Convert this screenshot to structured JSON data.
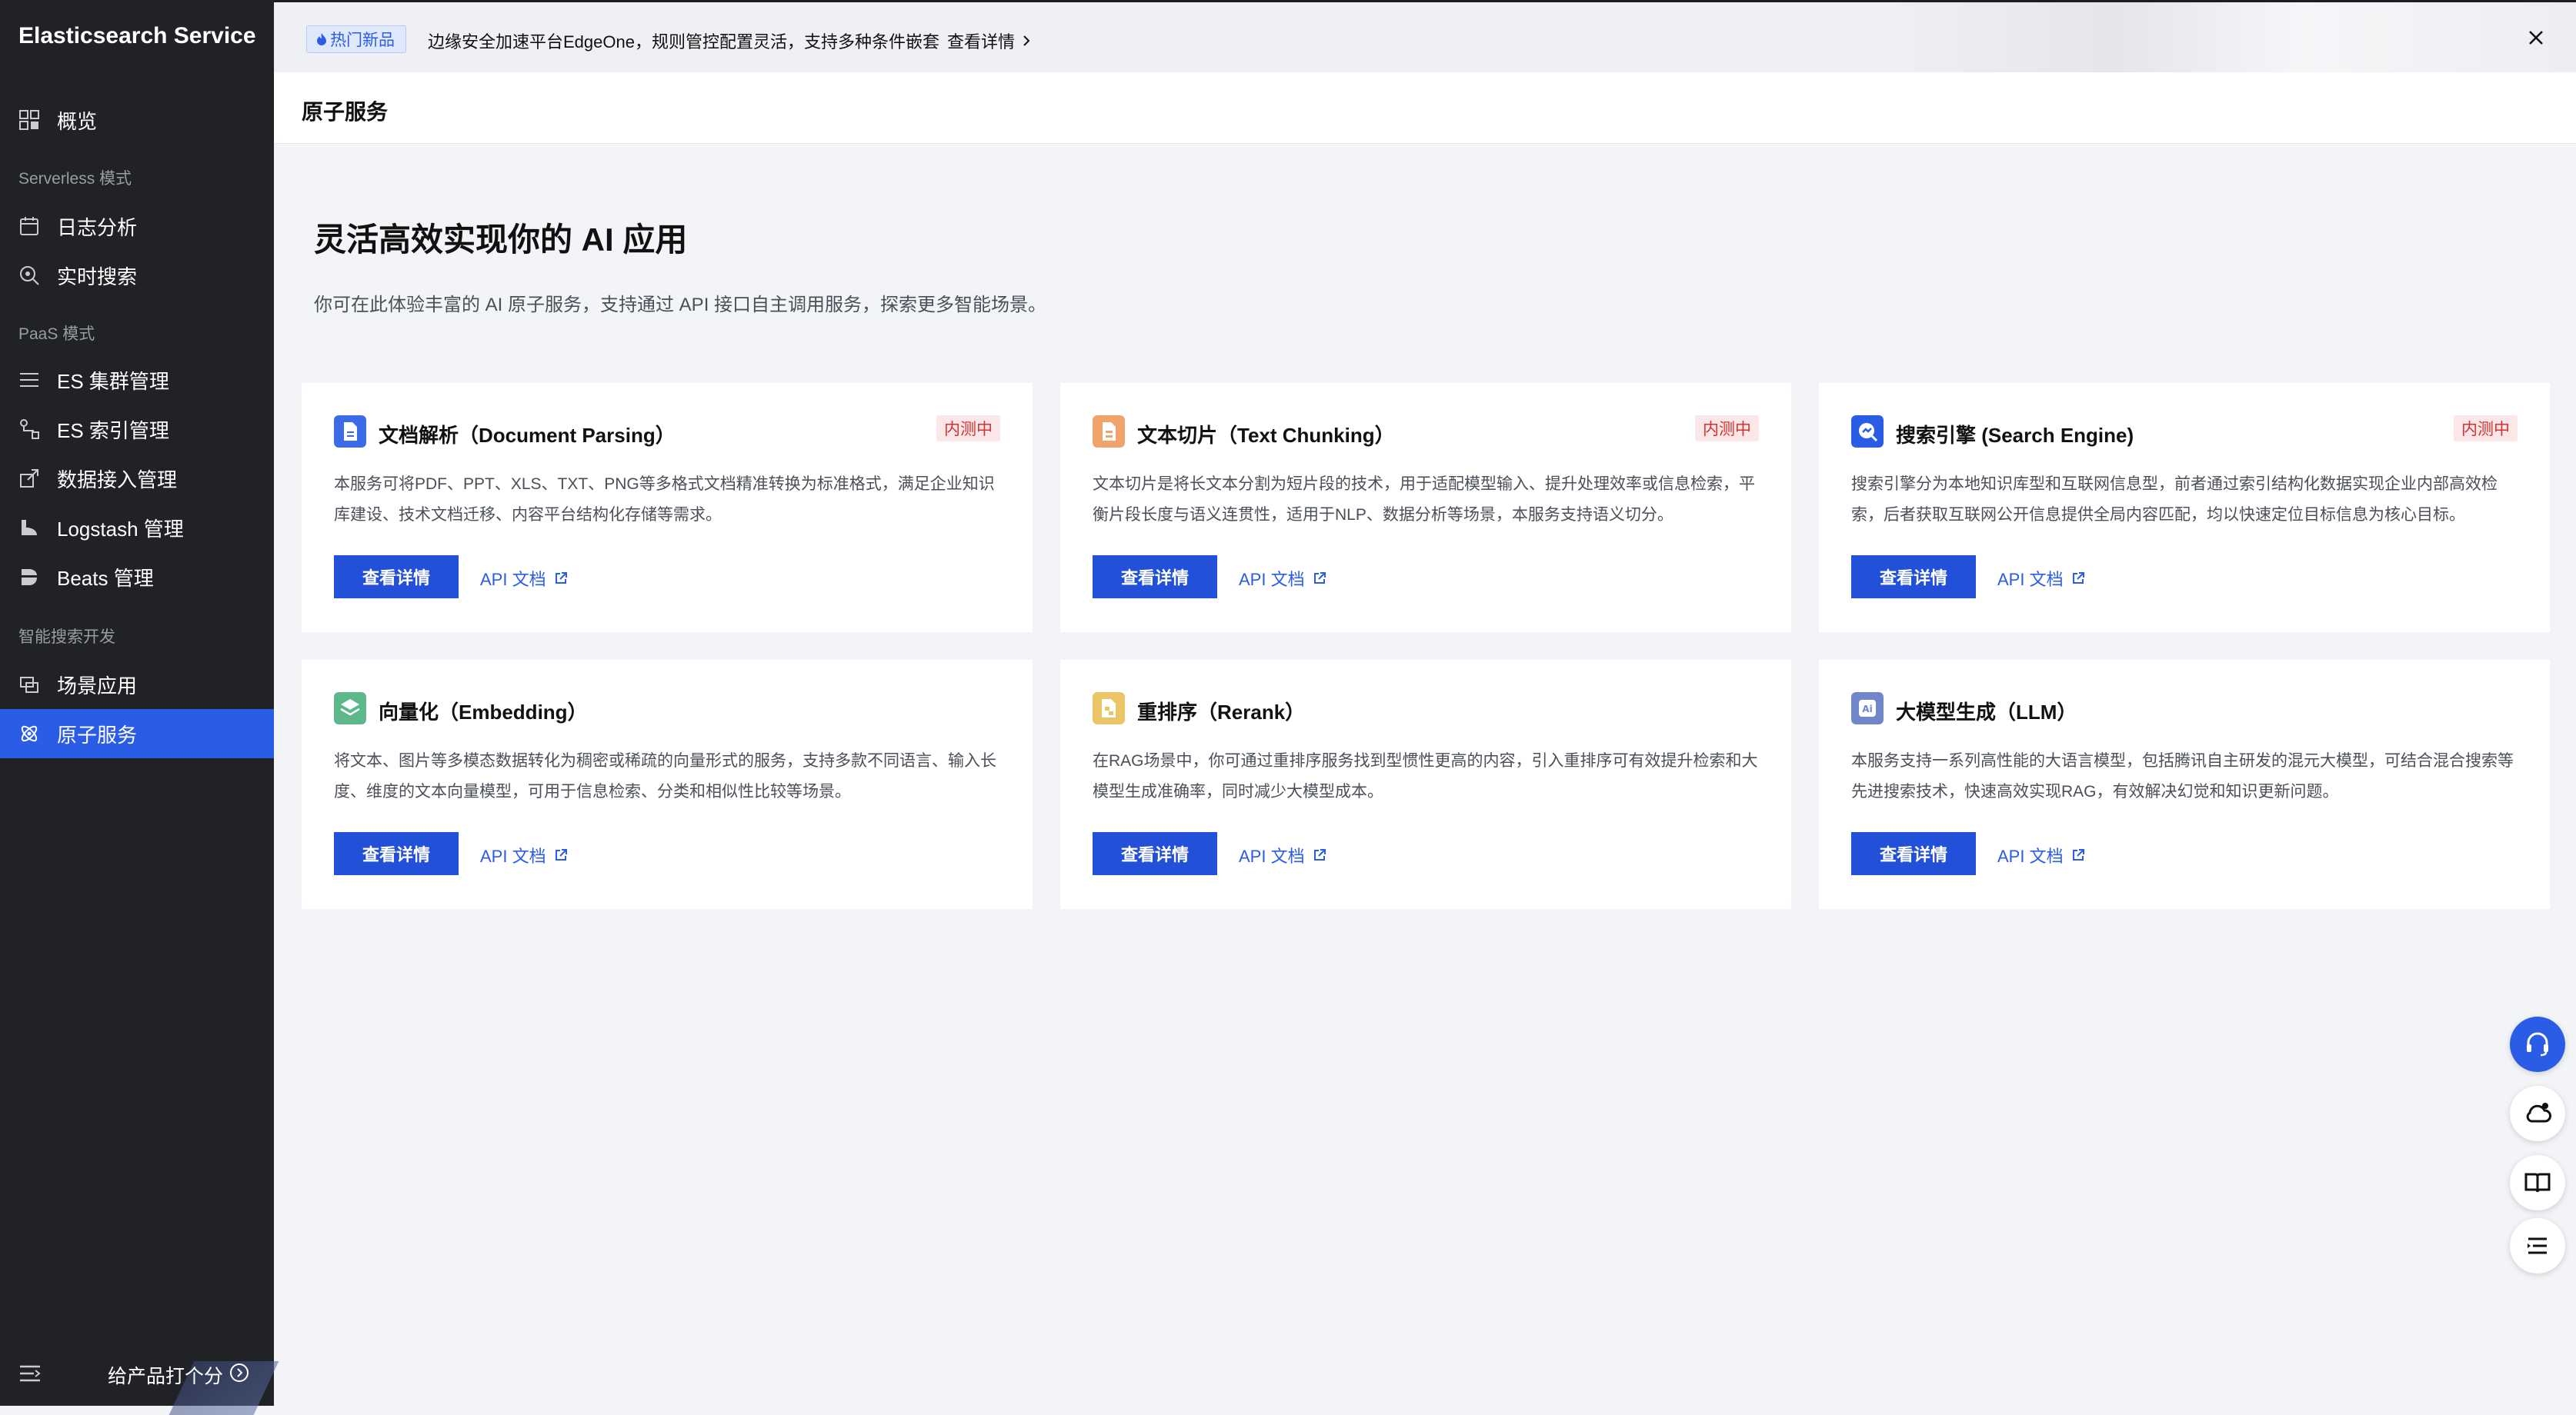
{
  "sidebar": {
    "brand": "Elasticsearch Service",
    "overview": "概览",
    "groups": [
      "Serverless 模式",
      "PaaS 模式",
      "智能搜索开发"
    ],
    "items": [
      {
        "label": "日志分析",
        "icon": "calendar-icon"
      },
      {
        "label": "实时搜索",
        "icon": "search-icon"
      },
      {
        "label": "ES 集群管理",
        "icon": "list-icon"
      },
      {
        "label": "ES 索引管理",
        "icon": "index-icon"
      },
      {
        "label": "数据接入管理",
        "icon": "import-icon"
      },
      {
        "label": "Logstash 管理",
        "icon": "logstash-icon"
      },
      {
        "label": "Beats 管理",
        "icon": "beats-icon"
      },
      {
        "label": "场景应用",
        "icon": "scene-icon"
      },
      {
        "label": "原子服务",
        "icon": "atom-icon",
        "active": true
      }
    ],
    "footer": {
      "rate_label": "给产品打个分"
    }
  },
  "banner": {
    "tag": "热门新品",
    "text": "边缘安全加速平台EdgeOne，规则管控配置灵活，支持多种条件嵌套",
    "link": "查看详情"
  },
  "page": {
    "title": "原子服务",
    "hero_title": "灵活高效实现你的 AI 应用",
    "hero_sub": "你可在此体验丰富的 AI 原子服务，支持通过 API 接口自主调用服务，探索更多智能场景。"
  },
  "cards": [
    {
      "title": "文档解析（Document Parsing）",
      "badge": "内测中",
      "desc": "本服务可将PDF、PPT、XLS、TXT、PNG等多格式文档精准转换为标准格式，满足企业知识库建设、技术文档迁移、内容平台结构化存储等需求。",
      "button": "查看详情",
      "link": "API 文档",
      "icon": "document-icon",
      "icon_color": "#3d6be8"
    },
    {
      "title": "文本切片（Text Chunking）",
      "badge": "内测中",
      "desc": "文本切片是将长文本分割为短片段的技术，用于适配模型输入、提升处理效率或信息检索，平衡片段长度与语义连贯性，适用于NLP、数据分析等场景，本服务支持语义切分。",
      "button": "查看详情",
      "link": "API 文档",
      "icon": "chunk-icon",
      "icon_color": "#f0a36b"
    },
    {
      "title": "搜索引擎 (Search Engine)",
      "badge": "内测中",
      "desc": "搜索引擎分为本地知识库型和互联网信息型，前者通过索引结构化数据实现企业内部高效检索，后者获取互联网公开信息提供全局内容匹配，均以快速定位目标信息为核心目标。",
      "button": "查看详情",
      "link": "API 文档",
      "icon": "search-engine-icon",
      "icon_color": "#2b5ce6"
    },
    {
      "title": "向量化（Embedding）",
      "badge": "",
      "desc": "将文本、图片等多模态数据转化为稠密或稀疏的向量形式的服务，支持多款不同语言、输入长度、维度的文本向量模型，可用于信息检索、分类和相似性比较等场景。",
      "button": "查看详情",
      "link": "API 文档",
      "icon": "embedding-icon",
      "icon_color": "#5cb88a"
    },
    {
      "title": "重排序（Rerank）",
      "badge": "",
      "desc": "在RAG场景中，你可通过重排序服务找到型惯性更高的内容，引入重排序可有效提升检索和大模型生成准确率，同时减少大模型成本。",
      "button": "查看详情",
      "link": "API 文档",
      "icon": "rerank-icon",
      "icon_color": "#ebc566"
    },
    {
      "title": "大模型生成（LLM）",
      "badge": "",
      "desc": "本服务支持一系列高性能的大语言模型，包括腾讯自主研发的混元大模型，可结合混合搜索等先进搜索技术，快速高效实现RAG，有效解决幻觉和知识更新问题。",
      "button": "查看详情",
      "link": "API 文档",
      "icon": "ai-icon",
      "icon_color": "#6f86c9"
    }
  ],
  "floating": [
    "headset-icon",
    "cloud-icon",
    "book-icon",
    "outline-icon"
  ]
}
